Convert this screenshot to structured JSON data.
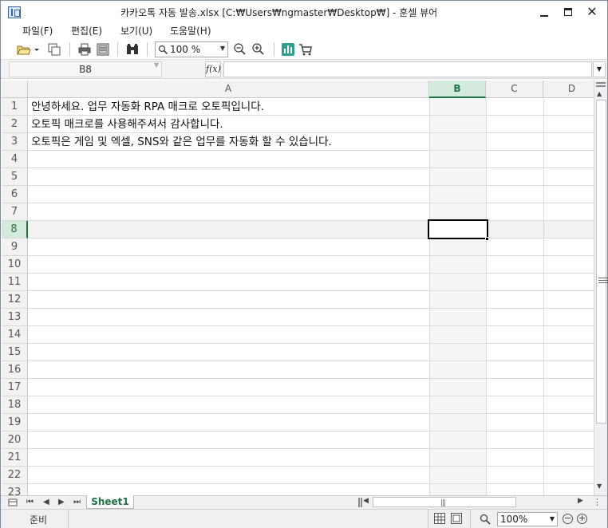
{
  "window": {
    "title": "카카오톡 자동 발송.xlsx [C:₩Users₩ngmaster₩Desktop₩] - 훈셀 뷰어",
    "minimize": "—",
    "maximize": "□",
    "close": "✕"
  },
  "menu": [
    {
      "label": "파일(F)"
    },
    {
      "label": "편집(E)"
    },
    {
      "label": "보기(U)"
    },
    {
      "label": "도움말(H)"
    }
  ],
  "toolbar": {
    "icons": [
      "open-folder-icon",
      "dropdown-arrow-icon",
      "copy-icon",
      "print-icon",
      "print-preview-icon",
      "find-icon",
      "zoom-icon",
      "zoom-out-icon",
      "zoom-in-icon",
      "chart-icon",
      "cart-icon"
    ],
    "zoom_value": "100 %"
  },
  "formula_bar": {
    "name_box": "B8",
    "fx_label": "f(x)",
    "formula": ""
  },
  "sheet": {
    "columns": [
      "A",
      "B",
      "C",
      "D"
    ],
    "active_column": "B",
    "rows": [
      "1",
      "2",
      "3",
      "4",
      "5",
      "6",
      "7",
      "8",
      "9",
      "10",
      "11",
      "12",
      "13",
      "14",
      "15",
      "16",
      "17",
      "18",
      "19",
      "20",
      "21",
      "22",
      "23"
    ],
    "active_row": "8",
    "cells": [
      {
        "ref": "A1",
        "value": "안녕하세요. 업무 자동화 RPA 매크로 오토픽입니다."
      },
      {
        "ref": "A2",
        "value": "오토픽 매크로를 사용해주셔서 감사합니다."
      },
      {
        "ref": "A3",
        "value": "오토픽은 게임 및 엑셀, SNS와 같은 업무를 자동화 할 수 있습니다."
      }
    ],
    "selected_cell": "B8"
  },
  "tabs": {
    "sheets": [
      {
        "label": "Sheet1",
        "active": true
      }
    ]
  },
  "status": {
    "text": "준비",
    "zoom_value": "100%",
    "zoom_out": "−",
    "zoom_in": "+"
  },
  "colors": {
    "accent": "#217346",
    "active_header_bg": "#d3eadc",
    "grid_line": "#d9d9d9"
  }
}
